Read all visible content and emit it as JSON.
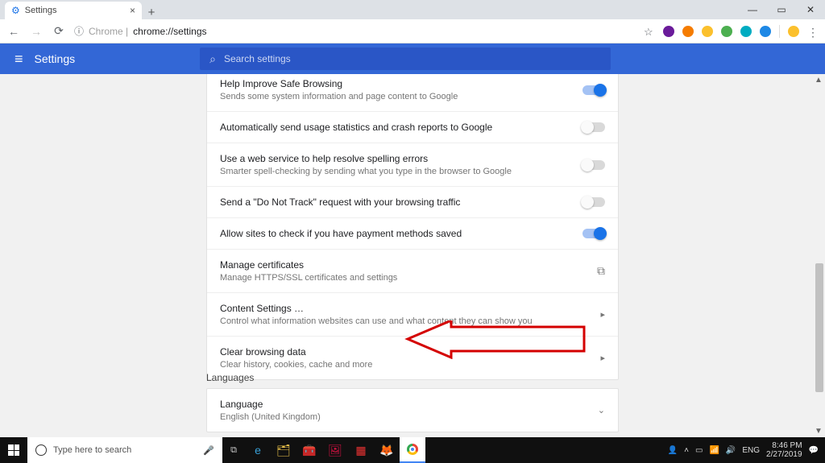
{
  "window": {
    "tab_title": "Settings",
    "minimize": "—",
    "maximize": "▭",
    "close": "✕",
    "newtab": "+"
  },
  "addressbar": {
    "back": "←",
    "forward": "→",
    "reload": "⟳",
    "protocol_label": "Chrome",
    "url_path": "chrome://settings",
    "star": "☆",
    "menu": "⋮"
  },
  "header": {
    "menu_icon": "≡",
    "title": "Settings",
    "search_placeholder": "Search settings",
    "search_icon": "⌕"
  },
  "settings_rows": [
    {
      "title": "Help Improve Safe Browsing",
      "sub": "Sends some system information and page content to Google",
      "control": "toggle",
      "on": true
    },
    {
      "title": "Automatically send usage statistics and crash reports to Google",
      "sub": "",
      "control": "toggle",
      "on": false
    },
    {
      "title": "Use a web service to help resolve spelling errors",
      "sub": "Smarter spell-checking by sending what you type in the browser to Google",
      "control": "toggle",
      "on": false
    },
    {
      "title": "Send a \"Do Not Track\" request with your browsing traffic",
      "sub": "",
      "control": "toggle",
      "on": false
    },
    {
      "title": "Allow sites to check if you have payment methods saved",
      "sub": "",
      "control": "toggle",
      "on": true
    },
    {
      "title": "Manage certificates",
      "sub": "Manage HTTPS/SSL certificates and settings",
      "control": "launch"
    },
    {
      "title": "Content Settings …",
      "sub": "Control what information websites can use and what content they can show you",
      "control": "chevron"
    },
    {
      "title": "Clear browsing data",
      "sub": "Clear history, cookies, cache and more",
      "control": "chevron"
    }
  ],
  "languages": {
    "section": "Languages",
    "row_title": "Language",
    "row_sub": "English (United Kingdom)"
  },
  "taskbar": {
    "search_placeholder": "Type here to search",
    "lang": "ENG",
    "time": "8:46 PM",
    "date": "2/27/2019"
  }
}
